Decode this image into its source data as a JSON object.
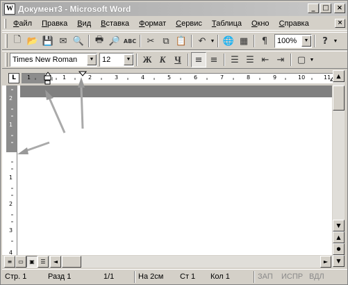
{
  "window": {
    "app_icon": "W",
    "title": "Документ3 - Microsoft Word",
    "controls": [
      "_",
      "□",
      "×"
    ]
  },
  "menu": {
    "items": [
      {
        "underlined": "Ф",
        "rest": "айл"
      },
      {
        "underlined": "П",
        "rest": "равка"
      },
      {
        "underlined": "В",
        "rest": "ид"
      },
      {
        "underlined": "В",
        "rest": "ставка"
      },
      {
        "underlined": "Ф",
        "rest": "ормат"
      },
      {
        "underlined": "С",
        "rest": "ервис"
      },
      {
        "underlined": "Т",
        "rest": "аблица"
      },
      {
        "underlined": "О",
        "rest": "кно"
      },
      {
        "underlined": "С",
        "rest": "правка"
      }
    ],
    "doc_controls": [
      "×"
    ]
  },
  "standard_toolbar": {
    "icons": [
      "new-doc-icon",
      "open-folder-icon",
      "save-icon",
      "email-icon",
      "search-doc-icon",
      "print-icon",
      "print-preview-icon",
      "spellcheck-icon",
      "cut-icon",
      "copy-icon",
      "paste-icon",
      "undo-icon",
      "hyperlink-icon",
      "table-icon",
      "pilcrow-icon",
      "help-icon"
    ],
    "glyphs": {
      "new": "🗋",
      "open": "📂",
      "save": "💾",
      "email": "✉",
      "search": "🔍",
      "print": "🖶",
      "preview": "🔎",
      "spell": "ABC",
      "cut": "✂",
      "copy": "⧉",
      "paste": "📋",
      "undo": "↶",
      "hyperlink": "🌐",
      "table": "▦",
      "pilcrow": "¶",
      "help": "?"
    },
    "zoom": "100%"
  },
  "format_toolbar": {
    "font_name": "Times New Roman",
    "font_size": "12",
    "bold": "Ж",
    "italic": "К",
    "underline": "Ч",
    "glyphs": {
      "align_left": "≡",
      "align_center": "≡",
      "numbering": "☰",
      "bullets": "☰",
      "outdent": "⇤",
      "indent": "⇥",
      "border": "▢"
    }
  },
  "ruler": {
    "tab_selector": "L",
    "h_numbers": [
      "1",
      "1",
      "2",
      "3",
      "4",
      "5",
      "6",
      "7",
      "8",
      "9",
      "10",
      "11"
    ],
    "v_numbers_margin": [
      "2",
      "1"
    ],
    "v_numbers_page": [
      "1",
      "2",
      "3",
      "4"
    ]
  },
  "scroll": {
    "up": "▲",
    "down": "▼",
    "prev_page": "▲",
    "next_page": "▼",
    "select_browse": "●",
    "left": "◄",
    "right": "►"
  },
  "status": {
    "page": "Стр. 1",
    "section": "Разд 1",
    "pages": "1/1",
    "at": "На 2см",
    "line": "Ст 1",
    "column": "Кол 1",
    "rec": "ЗАП",
    "trk": "ИСПР",
    "ext": "ВДЛ"
  }
}
